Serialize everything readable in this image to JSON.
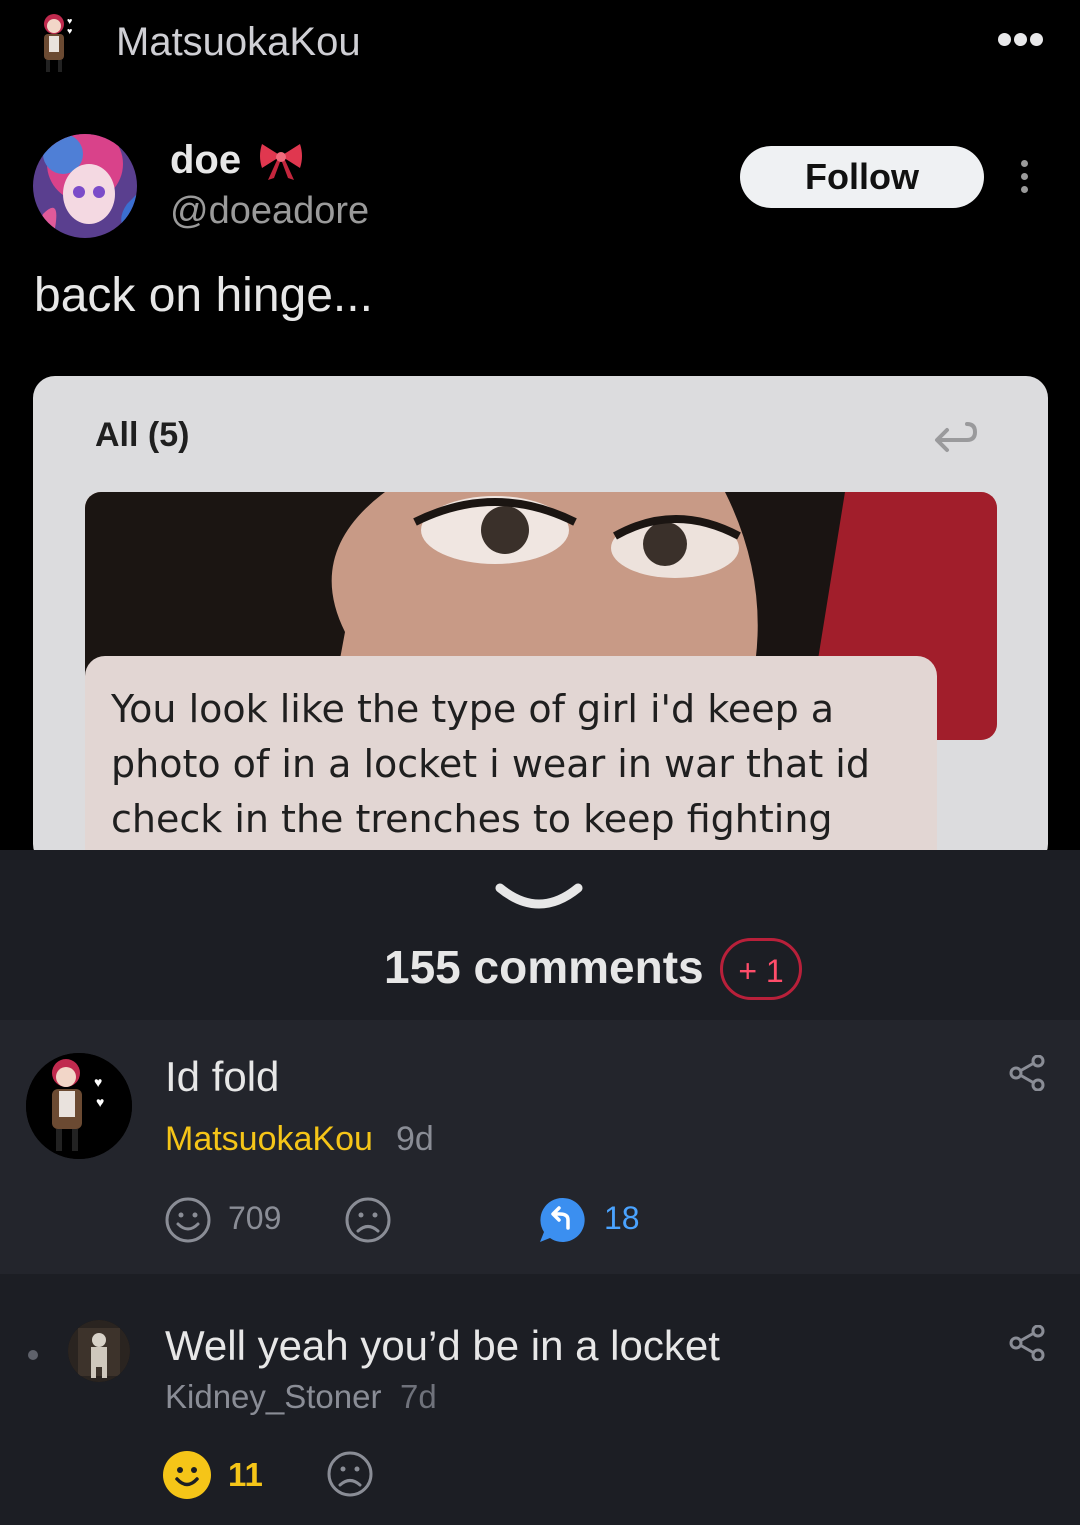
{
  "topbar": {
    "username": "MatsuokaKou"
  },
  "tweet": {
    "display_name": "doe",
    "handle": "@doeadore",
    "follow_label": "Follow",
    "text": "back on hinge..."
  },
  "card": {
    "filter_label": "All (5)",
    "quote": "You look like the type of girl i'd keep a photo of in a locket i wear in war that id check in the trenches to keep fighting"
  },
  "comments_header": {
    "count_label": "155 comments",
    "new_badge": "+ 1"
  },
  "comments": [
    {
      "text": "Id fold",
      "user": "MatsuokaKou",
      "age": "9d",
      "upvotes": "709",
      "replies": "18"
    },
    {
      "text": "Well yeah you’d be in a locket",
      "user": "Kidney_Stoner",
      "age": "7d",
      "upvotes": "11"
    }
  ],
  "colors": {
    "accent_user": "#f5c518",
    "reply_blue": "#4aa3ff",
    "badge_red": "#b8203a"
  }
}
